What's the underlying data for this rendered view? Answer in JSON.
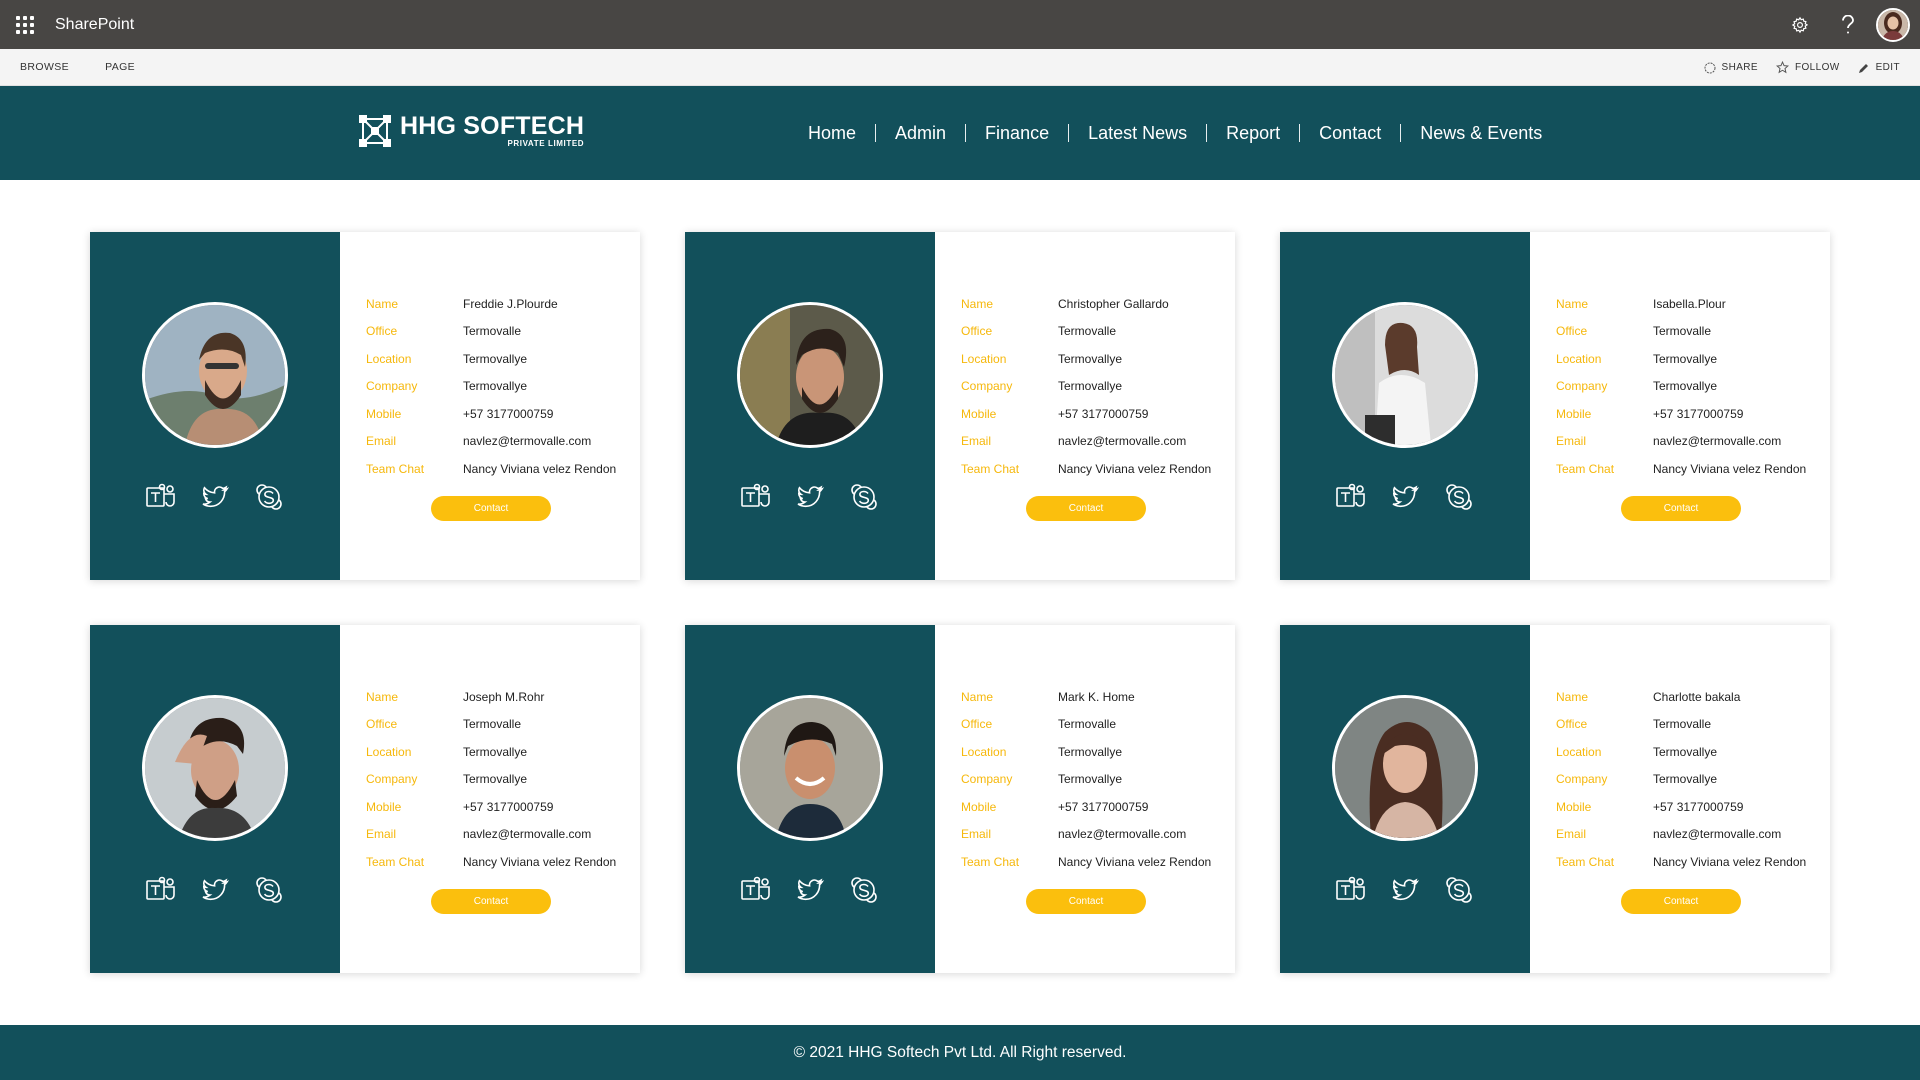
{
  "suitebar": {
    "app_name": "SharePoint"
  },
  "ribbon": {
    "tabs": [
      "BROWSE",
      "PAGE"
    ],
    "share": "SHARE",
    "follow": "FOLLOW",
    "edit": "EDIT"
  },
  "header": {
    "logo_main": "HHG SOFTECH",
    "logo_sub": "PRIVATE LIMITED",
    "nav": [
      "Home",
      "Admin",
      "Finance",
      "Latest News",
      "Report",
      "Contact",
      "News & Events"
    ]
  },
  "labels": {
    "name": "Name",
    "office": "Office",
    "location": "Location",
    "company": "Company",
    "mobile": "Mobile",
    "email": "Email",
    "team_chat": "Team Chat",
    "contact_button": "Contact"
  },
  "cards": [
    {
      "name": "Freddie J.Plourde",
      "office": "Termovalle",
      "location": "Termovallye",
      "company": "Termovallye",
      "mobile": "+57 3177000759",
      "email": "navlez@termovalle.com",
      "team_chat": "Nancy Viviana velez Rendon"
    },
    {
      "name": "Christopher Gallardo",
      "office": "Termovalle",
      "location": "Termovallye",
      "company": "Termovallye",
      "mobile": "+57 3177000759",
      "email": "navlez@termovalle.com",
      "team_chat": "Nancy Viviana velez Rendon"
    },
    {
      "name": "Isabella.Plour",
      "office": "Termovalle",
      "location": "Termovallye",
      "company": "Termovallye",
      "mobile": "+57 3177000759",
      "email": "navlez@termovalle.com",
      "team_chat": "Nancy Viviana velez Rendon"
    },
    {
      "name": "Joseph M.Rohr",
      "office": "Termovalle",
      "location": "Termovallye",
      "company": "Termovallye",
      "mobile": "+57 3177000759",
      "email": "navlez@termovalle.com",
      "team_chat": "Nancy Viviana velez Rendon"
    },
    {
      "name": "Mark K. Home",
      "office": "Termovalle",
      "location": "Termovallye",
      "company": "Termovallye",
      "mobile": "+57 3177000759",
      "email": "navlez@termovalle.com",
      "team_chat": "Nancy Viviana velez Rendon"
    },
    {
      "name": "Charlotte bakala",
      "office": "Termovalle",
      "location": "Termovallye",
      "company": "Termovallye",
      "mobile": "+57 3177000759",
      "email": "navlez@termovalle.com",
      "team_chat": "Nancy Viviana velez Rendon"
    }
  ],
  "footer": {
    "copyright": "© 2021 HHG Softech Pvt Ltd. All Right reserved."
  },
  "colors": {
    "teal": "#12505b",
    "accent": "#fbbf0d",
    "label": "#f6b80c",
    "suitebar": "#484644"
  },
  "icons": [
    "waffle-icon",
    "gear-icon",
    "help-icon",
    "share-icon",
    "follow-star-icon",
    "edit-pencil-icon",
    "teams-icon",
    "twitter-icon",
    "skype-icon"
  ]
}
